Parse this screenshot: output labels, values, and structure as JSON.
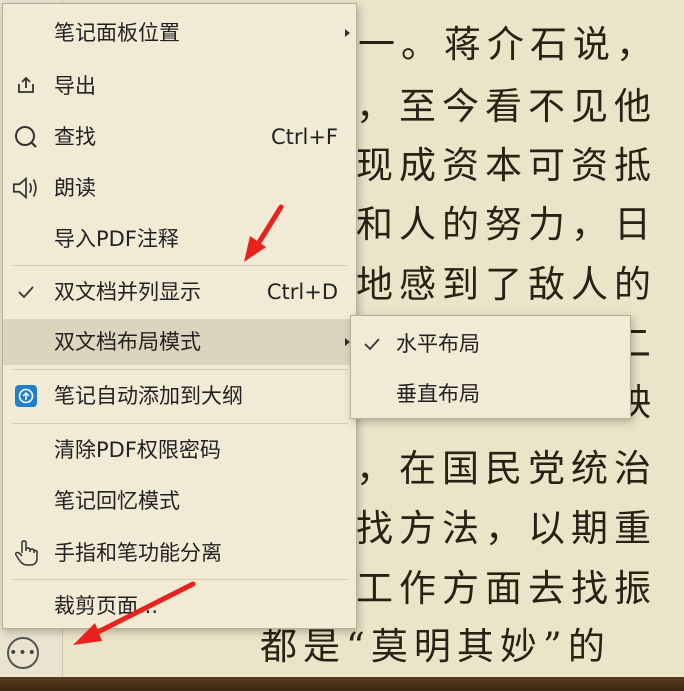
{
  "document": {
    "lines": [
      "一。蒋介石说，",
      "，至今看不见他",
      "现成资本可资抵",
      "和人的努力，日",
      "地感到了敌人的",
      "　　　　　　二",
      "　　　　　　映",
      "，在国民党统治",
      "找方法，以期重",
      "工作方面去找振",
      "都是“莫明其妙”的"
    ]
  },
  "menu": {
    "items": [
      {
        "label": "笔记面板位置",
        "icon": "",
        "shortcut": "",
        "submenu": true
      },
      {
        "label": "导出",
        "icon": "export-icon",
        "shortcut": ""
      },
      {
        "label": "查找",
        "icon": "search-icon",
        "shortcut": "Ctrl+F"
      },
      {
        "label": "朗读",
        "icon": "speaker-icon",
        "shortcut": ""
      },
      {
        "label": "导入PDF注释",
        "icon": "",
        "shortcut": ""
      },
      {
        "label": "双文档并列显示",
        "icon": "check-icon",
        "shortcut": "Ctrl+D",
        "checked": true
      },
      {
        "label": "双文档布局模式",
        "icon": "",
        "shortcut": "",
        "submenu": true,
        "highlighted": true
      },
      {
        "label": "笔记自动添加到大纲",
        "icon": "outline-app-icon",
        "shortcut": ""
      },
      {
        "label": "清除PDF权限密码",
        "icon": "",
        "shortcut": ""
      },
      {
        "label": "笔记回忆模式",
        "icon": "",
        "shortcut": ""
      },
      {
        "label": "手指和笔功能分离",
        "icon": "hand-pointer-icon",
        "shortcut": ""
      },
      {
        "label": "裁剪页面...",
        "icon": "",
        "shortcut": ""
      }
    ]
  },
  "submenu": {
    "items": [
      {
        "label": "水平布局",
        "checked": true
      },
      {
        "label": "垂直布局",
        "checked": false
      }
    ]
  },
  "toolbar": {
    "more_icon": "more-options-icon",
    "more_glyph": "•••"
  },
  "colors": {
    "annotation_arrow": "#e8231f",
    "menu_bg": "#f1ead4",
    "page_bg": "#ece4c8"
  }
}
